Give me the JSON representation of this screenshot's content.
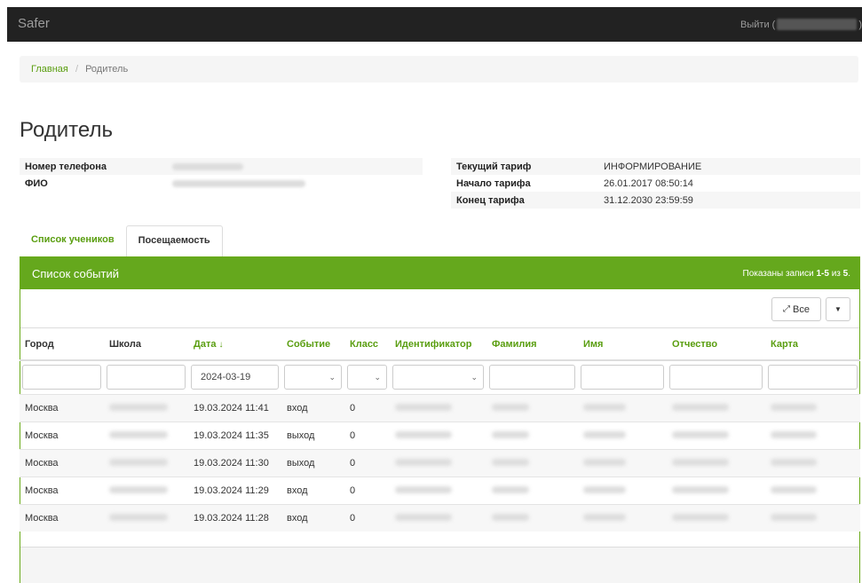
{
  "navbar": {
    "brand": "Safer",
    "logout_prefix": "Выйти (",
    "logout_suffix": ")"
  },
  "breadcrumb": {
    "home": "Главная",
    "separator": "/",
    "current": "Родитель"
  },
  "page_title": "Родитель",
  "info_left": [
    {
      "label": "Номер телефона"
    },
    {
      "label": "ФИО"
    }
  ],
  "info_right": [
    {
      "label": "Текущий тариф",
      "value": "ИНФОРМИРОВАНИЕ"
    },
    {
      "label": "Начало тарифа",
      "value": "26.01.2017 08:50:14"
    },
    {
      "label": "Конец тарифа",
      "value": "31.12.2030 23:59:59"
    }
  ],
  "tabs": {
    "students": "Список учеников",
    "attendance": "Посещаемость"
  },
  "panel": {
    "title": "Список событий",
    "summary_prefix": "Показаны записи ",
    "summary_range": "1-5",
    "summary_mid": " из ",
    "summary_total": "5",
    "summary_end": "."
  },
  "toolbar": {
    "all_label": "Все"
  },
  "columns": [
    "Город",
    "Школа",
    "Дата",
    "Событие",
    "Класс",
    "Идентификатор",
    "Фамилия",
    "Имя",
    "Отчество",
    "Карта"
  ],
  "filters": {
    "date": "2024-03-19"
  },
  "rows": [
    {
      "city": "Москва",
      "date": "19.03.2024 11:41",
      "event": "вход",
      "class": "0"
    },
    {
      "city": "Москва",
      "date": "19.03.2024 11:35",
      "event": "выход",
      "class": "0"
    },
    {
      "city": "Москва",
      "date": "19.03.2024 11:30",
      "event": "выход",
      "class": "0"
    },
    {
      "city": "Москва",
      "date": "19.03.2024 11:29",
      "event": "вход",
      "class": "0"
    },
    {
      "city": "Москва",
      "date": "19.03.2024 11:28",
      "event": "вход",
      "class": "0"
    }
  ],
  "colors": {
    "accent": "#65a81d",
    "link": "#5a9e10",
    "navbar": "#222222"
  }
}
